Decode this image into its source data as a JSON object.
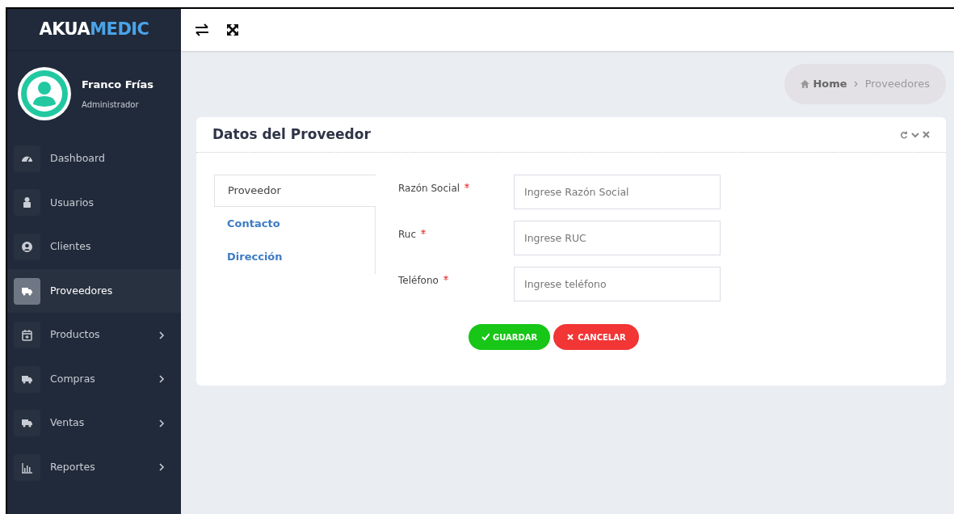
{
  "brand": {
    "part_1": "AKUA",
    "part_2": "MEDIC"
  },
  "user": {
    "name": "Franco Frías",
    "role": "Administrador"
  },
  "sidebar": {
    "items": [
      {
        "label": "Dashboard",
        "selected": false,
        "expandable": false
      },
      {
        "label": "Usuarios",
        "selected": false,
        "expandable": false
      },
      {
        "label": "Clientes",
        "selected": false,
        "expandable": false
      },
      {
        "label": "Proveedores",
        "selected": true,
        "expandable": false
      },
      {
        "label": "Productos",
        "selected": false,
        "expandable": true
      },
      {
        "label": "Compras",
        "selected": false,
        "expandable": true
      },
      {
        "label": "Ventas",
        "selected": false,
        "expandable": true
      },
      {
        "label": "Reportes",
        "selected": false,
        "expandable": true
      }
    ]
  },
  "breadcrumb": [
    {
      "label": "Home"
    },
    {
      "label": "Proveedores"
    }
  ],
  "card": {
    "title": "Datos del Proveedor",
    "tabs": [
      {
        "label": "Proveedor",
        "selected": true
      },
      {
        "label": "Contacto",
        "selected": false
      },
      {
        "label": "Dirección",
        "selected": false
      }
    ],
    "fields": [
      {
        "label": "Razón Social",
        "required": true,
        "placeholder": "Ingrese Razón Social"
      },
      {
        "label": "Ruc",
        "required": true,
        "placeholder": "Ingrese RUC"
      },
      {
        "label": "Teléfono",
        "required": true,
        "placeholder": "Ingrese teléfono"
      }
    ],
    "buttons": [
      {
        "kind": "save",
        "label": "GUARDAR"
      },
      {
        "kind": "cancel",
        "label": "CANCELAR"
      }
    ]
  }
}
